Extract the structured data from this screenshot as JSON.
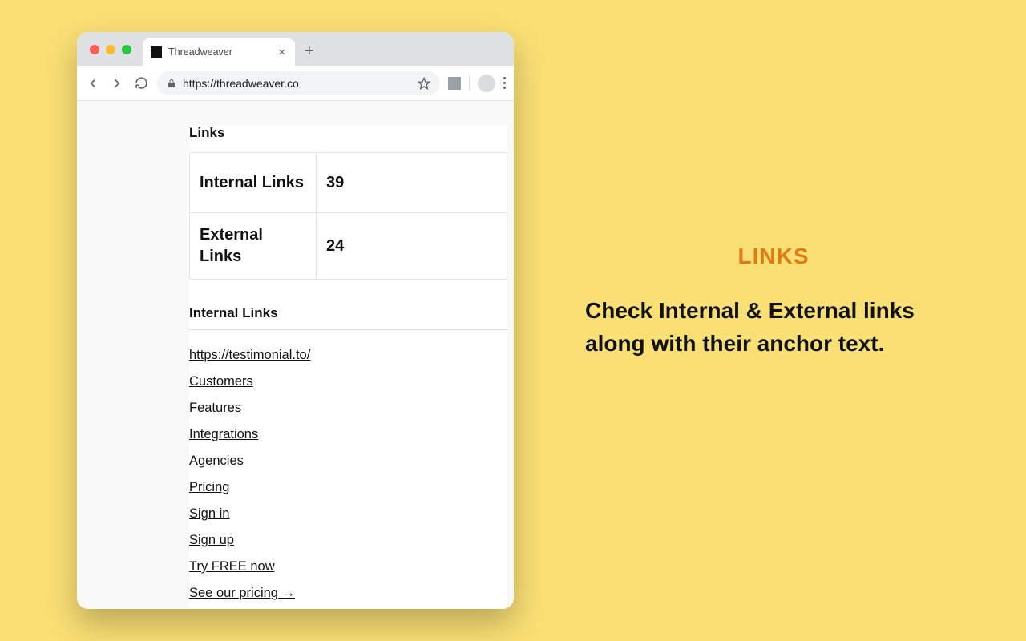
{
  "browser": {
    "tab_title": "Threadweaver",
    "url": "https://threadweaver.co"
  },
  "page": {
    "links_heading": "Links",
    "rows": [
      {
        "label": "Internal Links",
        "value": "39"
      },
      {
        "label": "External Links",
        "value": "24"
      }
    ],
    "internal_links_heading": "Internal Links",
    "internal_links": [
      "https://testimonial.to/",
      "Customers",
      "Features",
      "Integrations",
      "Agencies",
      "Pricing",
      "Sign in",
      "Sign up",
      "Try FREE now",
      "See our pricing →"
    ]
  },
  "promo": {
    "title": "LINKS",
    "description": "Check Internal & External links along with their anchor text."
  }
}
